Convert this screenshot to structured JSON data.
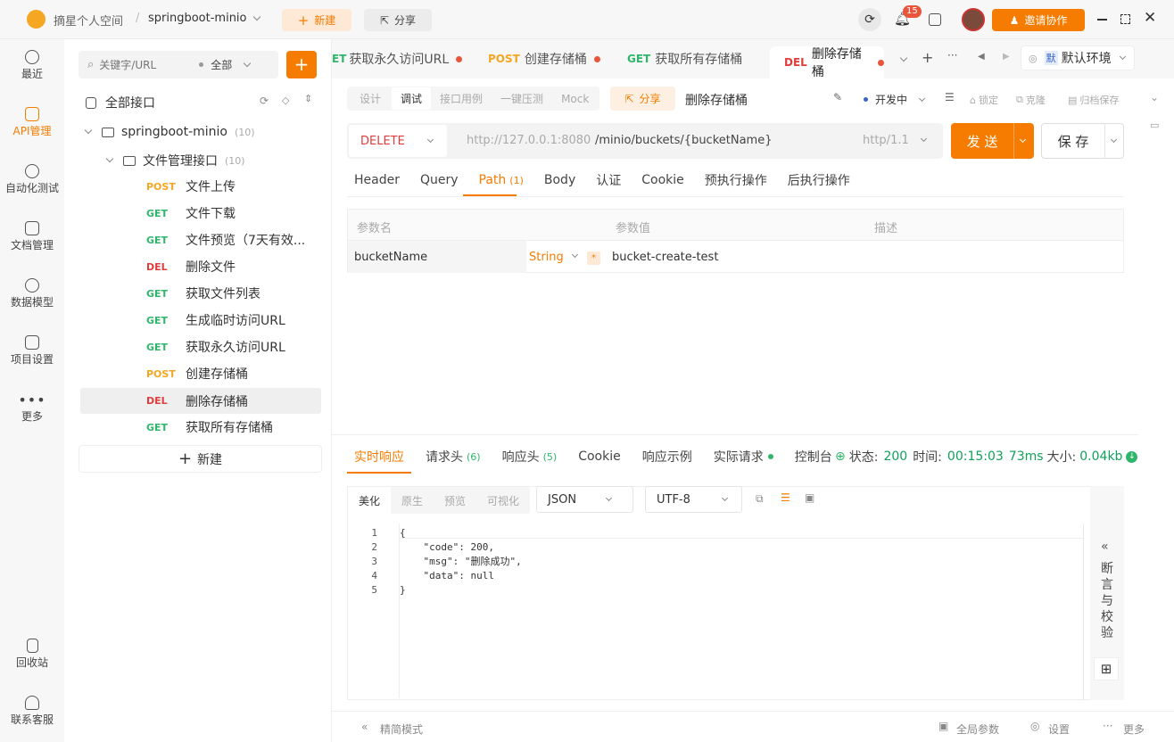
{
  "app": {
    "workspace": "摘星个人空间",
    "project": "springboot-minio",
    "new_label": "新建",
    "share_label": "分享",
    "notif_count": "15",
    "invite_label": "邀请协作"
  },
  "rail": {
    "items": [
      {
        "label": "最近",
        "icon": "clock-icon"
      },
      {
        "label": "API管理",
        "icon": "api-icon"
      },
      {
        "label": "自动化测试",
        "icon": "flow-icon"
      },
      {
        "label": "文档管理",
        "icon": "document-icon"
      },
      {
        "label": "数据模型",
        "icon": "model-icon"
      },
      {
        "label": "项目设置",
        "icon": "settings-icon"
      },
      {
        "label": "更多",
        "icon": "more-icon"
      }
    ],
    "bottom": [
      {
        "label": "回收站",
        "icon": "trash-icon"
      },
      {
        "label": "联系客服",
        "icon": "headset-icon"
      }
    ]
  },
  "tree": {
    "search_placeholder": "关键字/URL",
    "filter": "全部",
    "root": "全部接口",
    "project": "springboot-minio",
    "project_count": "(10)",
    "folder": "文件管理接口",
    "folder_count": "(10)",
    "items": [
      {
        "method": "POST",
        "name": "文件上传"
      },
      {
        "method": "GET",
        "name": "文件下载"
      },
      {
        "method": "GET",
        "name": "文件预览（7天有效..."
      },
      {
        "method": "DEL",
        "name": "删除文件"
      },
      {
        "method": "GET",
        "name": "获取文件列表"
      },
      {
        "method": "GET",
        "name": "生成临时访问URL"
      },
      {
        "method": "GET",
        "name": "获取永久访问URL"
      },
      {
        "method": "POST",
        "name": "创建存储桶"
      },
      {
        "method": "DEL",
        "name": "删除存储桶"
      },
      {
        "method": "GET",
        "name": "获取所有存储桶"
      }
    ],
    "new_label": "新建"
  },
  "tabs": {
    "items": [
      {
        "method": "ET",
        "name": "获取永久访问URL"
      },
      {
        "method": "POST",
        "name": "创建存储桶"
      },
      {
        "method": "GET",
        "name": "获取所有存储桶"
      },
      {
        "method": "DEL",
        "name": "删除存储桶"
      }
    ],
    "env_badge": "默",
    "env": "默认环境"
  },
  "subtabs": {
    "items": [
      "设计",
      "调试",
      "接口用例",
      "一键压测",
      "Mock"
    ],
    "share": "分享",
    "api_name": "删除存储桶",
    "status": "开发中",
    "lock": "锁定",
    "clone": "克隆",
    "archive": "归档保存"
  },
  "request": {
    "method": "DELETE",
    "host": "http://127.0.0.1:8080",
    "path": "/minio/buckets/{bucketName}",
    "protocol": "http/1.1",
    "send": "发 送",
    "save": "保 存",
    "tabs": [
      "Header",
      "Query",
      "Path",
      "Body",
      "认证",
      "Cookie",
      "预执行操作",
      "后执行操作"
    ],
    "path_count": "(1)",
    "param_headers": [
      "参数名",
      "参数值",
      "描述"
    ],
    "param": {
      "name": "bucketName",
      "type": "String",
      "required": "*",
      "value": "bucket-create-test"
    }
  },
  "response": {
    "tabs": [
      "实时响应",
      "请求头",
      "响应头",
      "Cookie",
      "响应示例",
      "实际请求",
      "控制台"
    ],
    "req_header_count": "(6)",
    "resp_header_count": "(5)",
    "status_label": "状态:",
    "status": "200",
    "time_label": "时间:",
    "time": "00:15:03",
    "duration": "73ms",
    "size_label": "大小:",
    "size": "0.04kb",
    "view_modes": [
      "美化",
      "原生",
      "预览",
      "可视化"
    ],
    "format": "JSON",
    "encoding": "UTF-8",
    "code_lines": [
      "{",
      "    \"code\": 200,",
      "    \"msg\": \"删除成功\",",
      "    \"data\": null",
      "}"
    ],
    "side_label": "断言与校验"
  },
  "footer": {
    "simple_mode": "精简模式",
    "global_params": "全局参数",
    "settings": "设置",
    "more": "更多"
  },
  "colors": {
    "accent": "#f57c00",
    "get": "#2fb66b",
    "post": "#f5a623",
    "del": "#e03c3c"
  }
}
